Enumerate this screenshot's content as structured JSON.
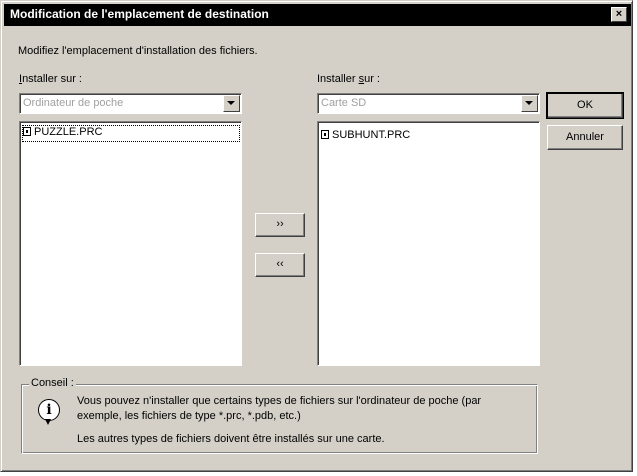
{
  "dialog": {
    "title": "Modification de l'emplacement de destination",
    "close_label": "×",
    "instructions": "Modifiez l'emplacement d'installation des fichiers."
  },
  "left": {
    "label_accel": "I",
    "label_rest": "nstaller sur :",
    "combo_value": "Ordinateur de poche",
    "files": [
      "PUZZLE.PRC"
    ]
  },
  "right": {
    "label_pre": "Installer ",
    "label_accel": "s",
    "label_rest": "ur :",
    "combo_value": "Carte SD",
    "files": [
      "SUBHUNT.PRC"
    ]
  },
  "buttons": {
    "move_right": "››",
    "move_left": "‹‹",
    "ok": "OK",
    "cancel": "Annuler"
  },
  "tip": {
    "legend": "Conseil :",
    "line1": "Vous pouvez n'installer que certains types de fichiers sur l'ordinateur de poche (par",
    "line2": "exemple, les fichiers de type *.prc, *.pdb, etc.)",
    "line3": "Les autres types de fichiers doivent être installés sur une carte."
  },
  "icons": [
    "close-icon",
    "dropdown-arrow-icon",
    "file-icon",
    "info-icon"
  ],
  "colors": {
    "title_bg": "#000000",
    "title_fg": "#ffffff",
    "face": "#d4d0c8",
    "disabled_text": "#a0a0a0"
  }
}
